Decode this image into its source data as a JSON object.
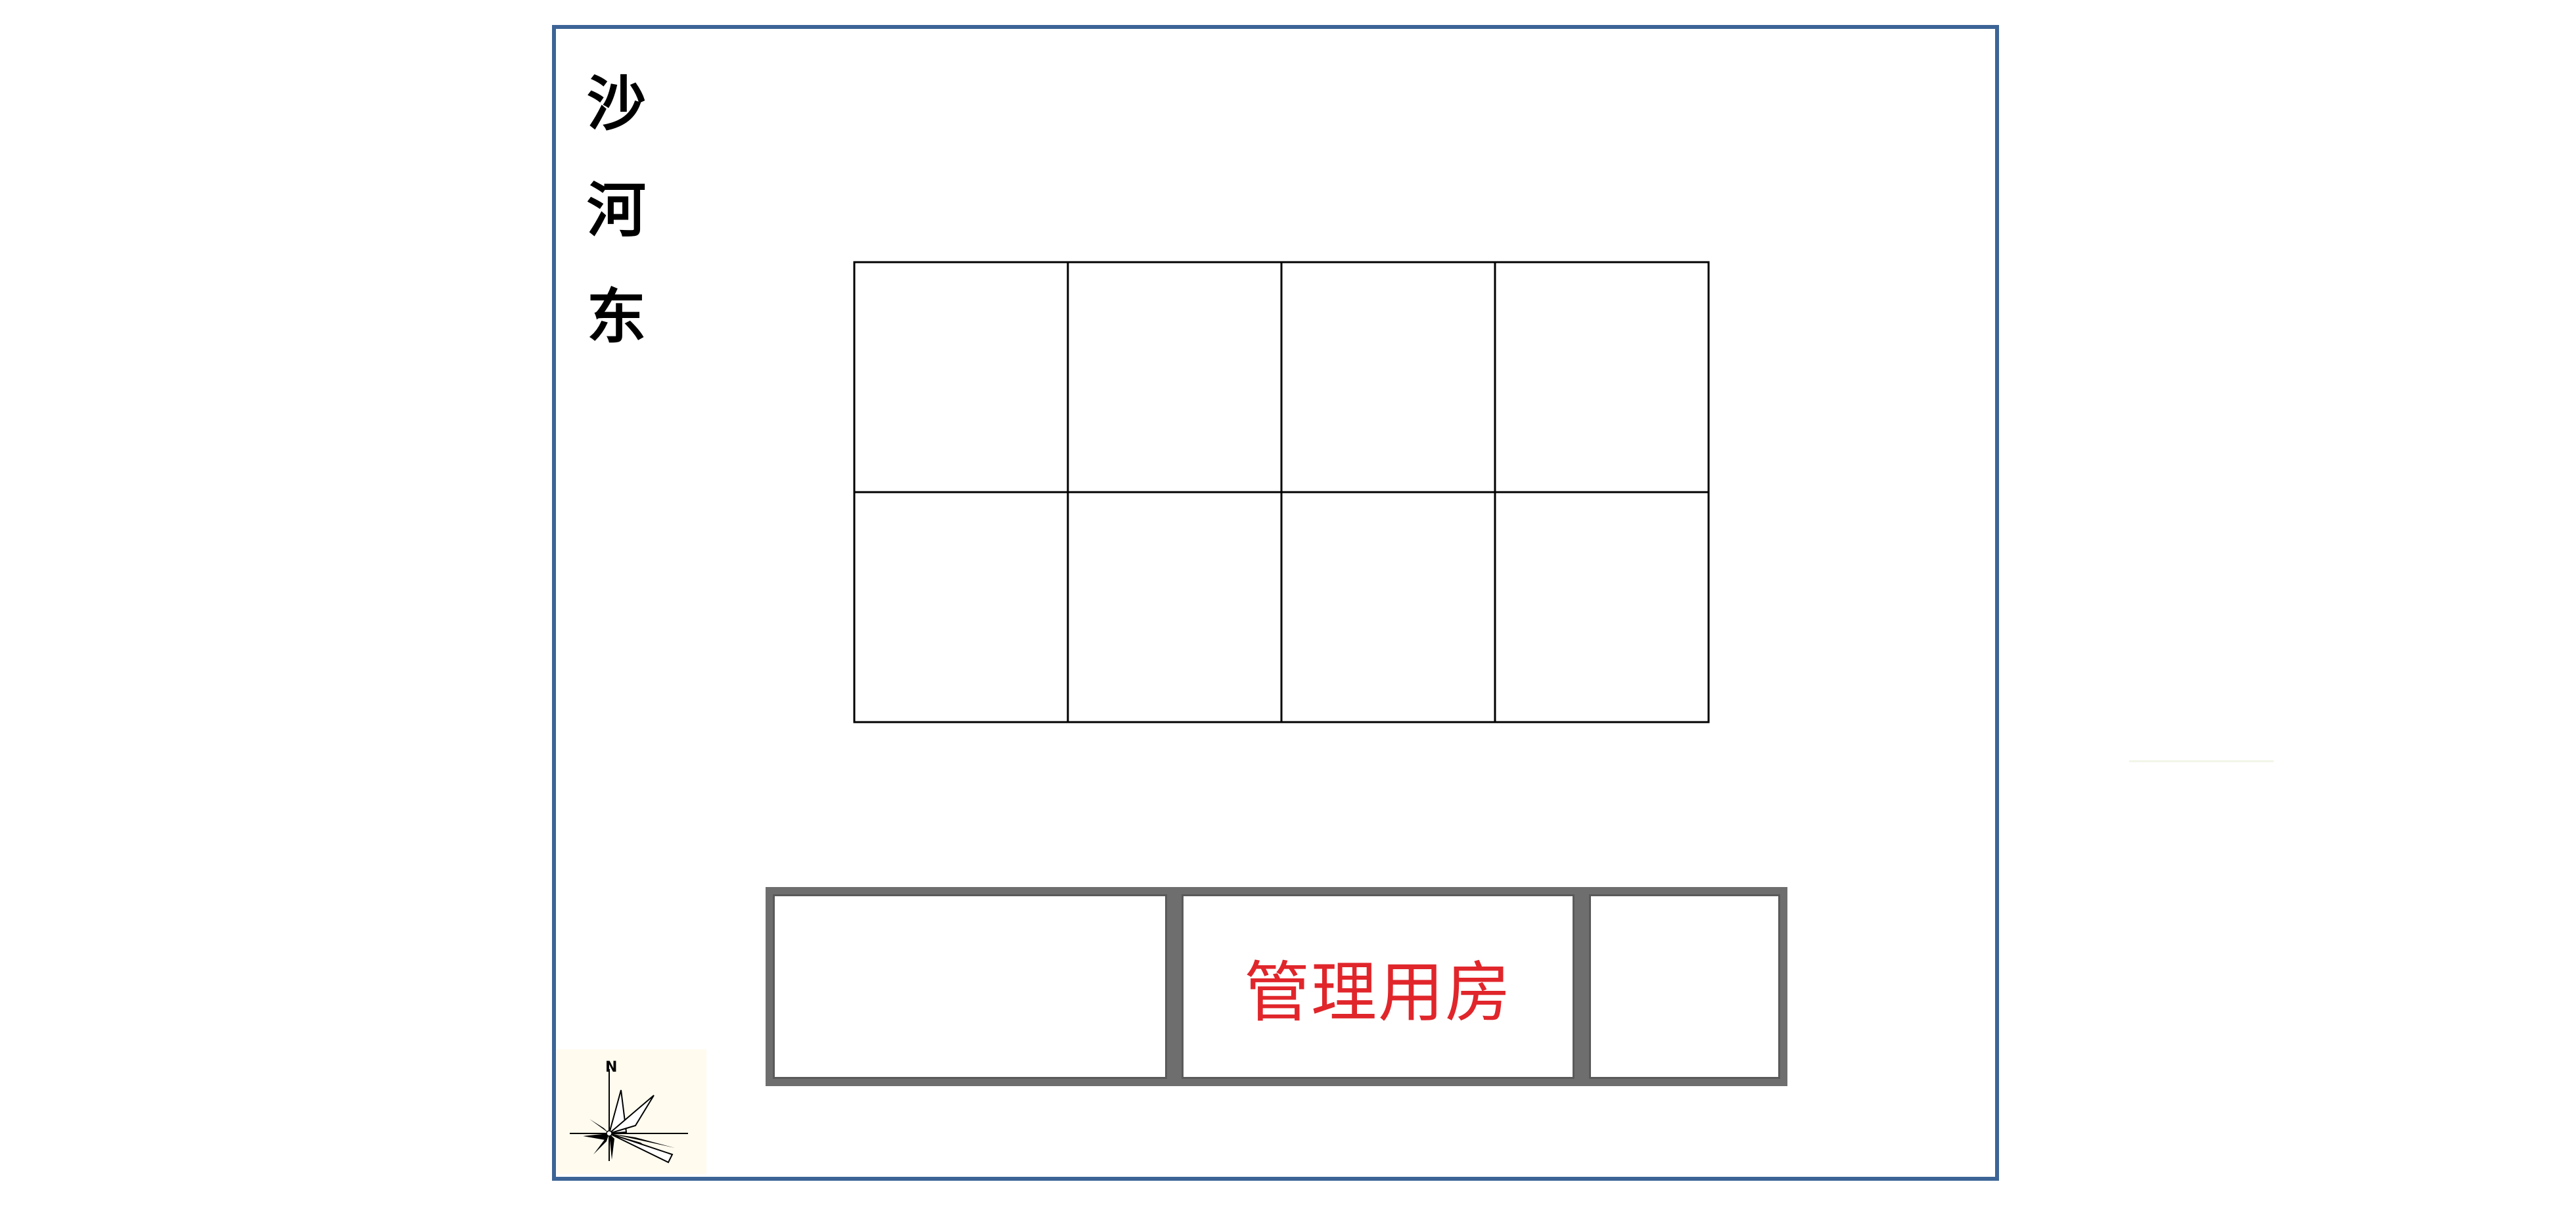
{
  "site": {
    "road_label": "沙河东"
  },
  "parking_grid": {
    "rows": 2,
    "columns": 4
  },
  "buildings": [
    {
      "label": ""
    },
    {
      "label": "管理用房"
    },
    {
      "label": ""
    }
  ],
  "compass": {
    "north_letter": "N"
  },
  "colors": {
    "boundary": "#3c6496",
    "building_wall": "#6e6e6e",
    "building_label": "#e0262b",
    "grid_line": "#000000"
  }
}
